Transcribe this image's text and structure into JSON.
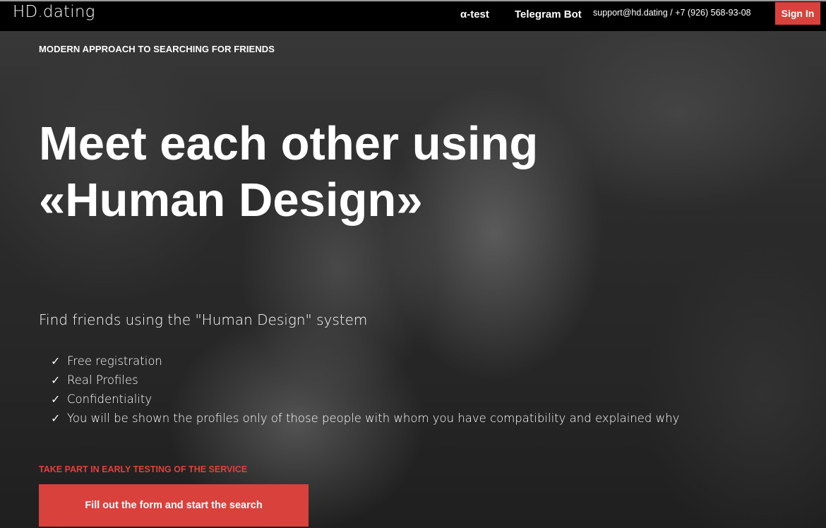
{
  "navbar": {
    "logo": "HD.dating",
    "alpha_test": "α-test",
    "telegram_bot": "Telegram Bot",
    "contact": "support@hd.dating / +7 (926) 568-93-08",
    "sign_in": "Sign In"
  },
  "hero": {
    "tagline": "MODERN APPROACH TO SEARCHING FOR FRIENDS",
    "headline_line1": "Meet each other using",
    "headline_line2": "«Human Design»",
    "subtitle": "Find friends using the \"Human Design\" system",
    "features": [
      "Free registration",
      "Real Profiles",
      "Confidentiality",
      "You will be shown the profiles only of those people with whom you have compatibility and explained why"
    ],
    "check_glyph": "✓",
    "cta_label": "TAKE PART IN EARLY TESTING OF THE SERVICE",
    "cta_button": "Fill out the form and start the search"
  },
  "colors": {
    "accent": "#d9413c",
    "navbar_bg": "#000000"
  }
}
